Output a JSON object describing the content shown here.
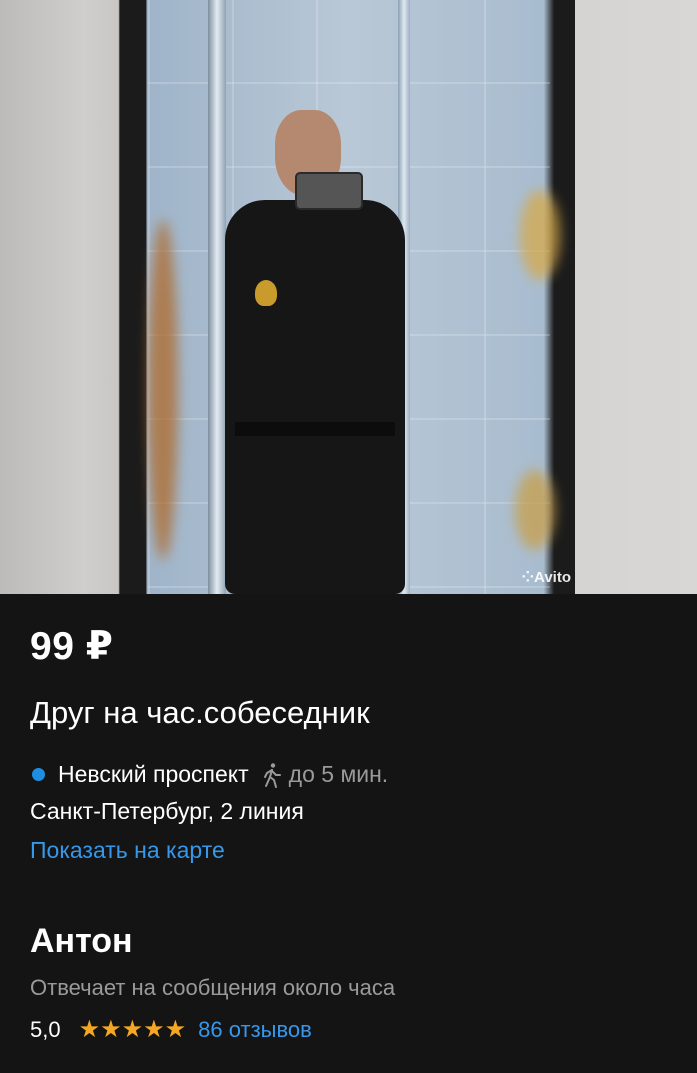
{
  "photo": {
    "watermark": "Avito"
  },
  "listing": {
    "price": "99 ₽",
    "title": "Друг на час.собеседник",
    "metro_station": "Невский проспект",
    "walk_time": "до 5 мин.",
    "address": "Санкт-Петербург, 2 линия",
    "map_link": "Показать на карте"
  },
  "seller": {
    "name": "Антон",
    "reply_time": "Отвечает на сообщения около часа",
    "rating": "5,0",
    "stars": "★★★★★",
    "reviews_link": "86 отзывов"
  },
  "colors": {
    "background": "#141414",
    "link": "#3598eb",
    "metro_dot": "#1e8fe0",
    "stars": "#f5a623",
    "secondary_text": "#9a9a9a"
  },
  "icons": [
    "metro-dot-icon",
    "walking-person-icon",
    "star-icon"
  ]
}
